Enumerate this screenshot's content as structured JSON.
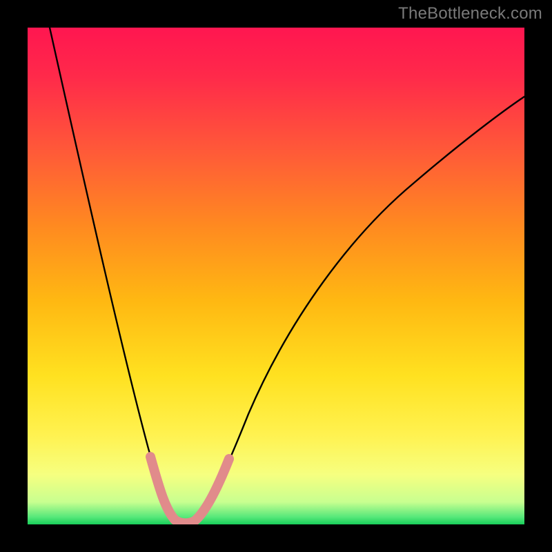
{
  "watermark": "TheBottleneck.com",
  "colors": {
    "background_frame": "#000000",
    "watermark_text": "#7a7a7a",
    "curve": "#000000",
    "highlight": "#e18b8b",
    "gradient_stops": [
      "#ff1650",
      "#ff2a4a",
      "#ff5a38",
      "#ff8a20",
      "#ffb812",
      "#ffe120",
      "#fff250",
      "#f6ff80",
      "#c8ff90",
      "#57e87a",
      "#18cf5a"
    ]
  },
  "chart_data": {
    "type": "line",
    "title": "",
    "xlabel": "",
    "ylabel": "",
    "xlim": [
      0,
      100
    ],
    "ylim": [
      0,
      100
    ],
    "grid": false,
    "legend": null,
    "description": "Single black curve on a red-to-green vertical gradient. The curve drops steeply from the top-left, reaches a narrow minimum near the bottom around x≈31, then rises more gradually toward the upper right. A short salmon-colored band highlights the bottom of the valley (roughly x 25–40).",
    "series": [
      {
        "name": "curve",
        "x": [
          4,
          8,
          12,
          16,
          20,
          24,
          26,
          28,
          30,
          31,
          32,
          34,
          36,
          40,
          46,
          54,
          62,
          72,
          84,
          96,
          100
        ],
        "y": [
          100,
          82,
          66,
          52,
          38,
          22,
          15,
          8,
          3,
          1,
          0,
          2,
          6,
          15,
          28,
          44,
          56,
          67,
          78,
          86,
          88
        ]
      }
    ],
    "highlight_range_x": [
      25,
      40
    ],
    "minimum": {
      "x": 31,
      "y": 0
    }
  }
}
